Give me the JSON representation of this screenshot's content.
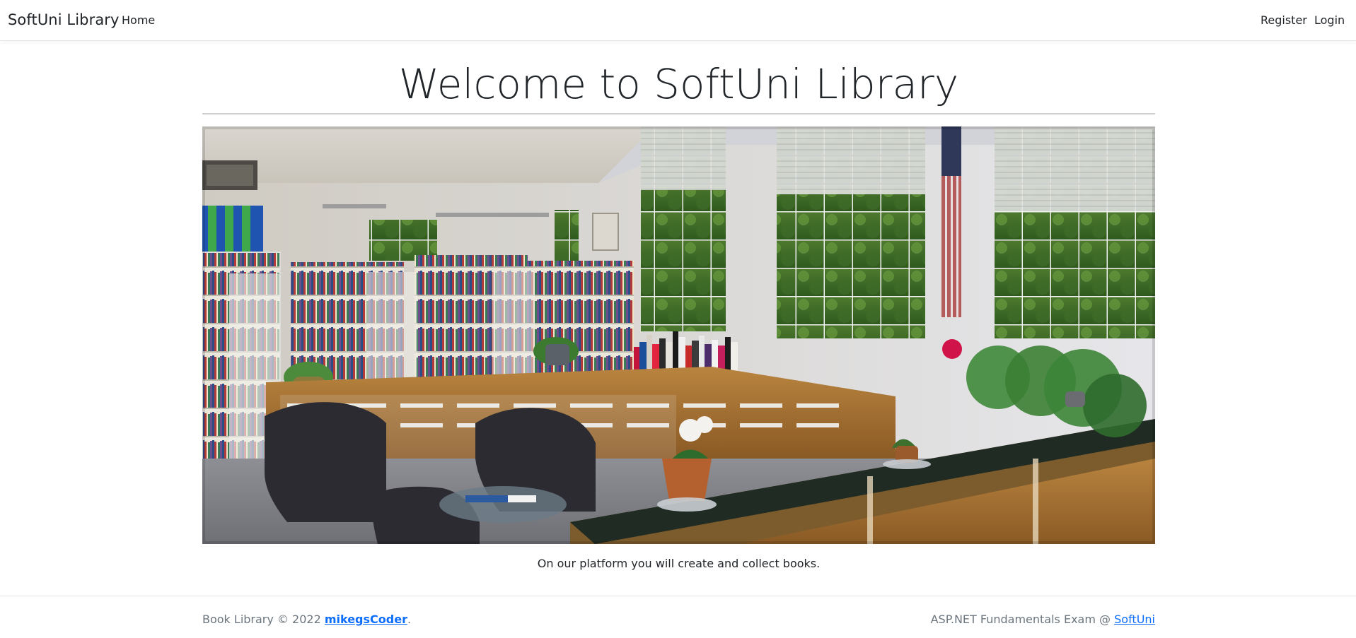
{
  "navbar": {
    "brand": "SoftUni Library",
    "home": "Home",
    "register": "Register",
    "login": "Login"
  },
  "main": {
    "title": "Welcome to SoftUni Library",
    "caption": "On our platform you will create and collect books."
  },
  "footer": {
    "left_prefix": "Book Library © 2022 ",
    "left_link": "mikegsCoder",
    "left_suffix": ".",
    "right_prefix": "ASP.NET Fundamentals Exam @ ",
    "right_link": "SoftUni"
  },
  "colors": {
    "link": "#0d6efd",
    "muted": "#6c757d",
    "text": "#212529"
  }
}
